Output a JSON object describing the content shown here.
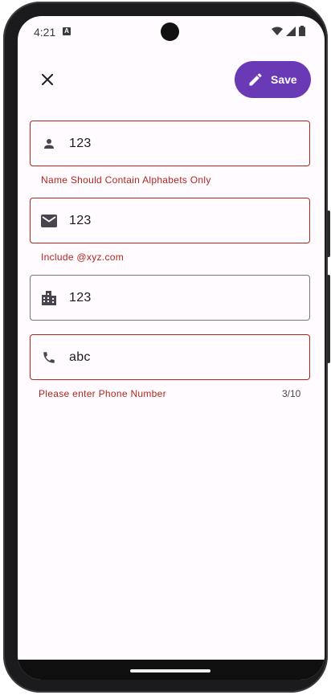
{
  "status_bar": {
    "time": "4:21",
    "a_icon": "A"
  },
  "app_bar": {
    "close_icon": "close-icon",
    "save_label": "Save",
    "save_icon": "pencil-icon"
  },
  "fields": [
    {
      "icon": "person-icon",
      "value": "123",
      "supporting_text": "Name Should Contain Alphabets Only",
      "state": "error"
    },
    {
      "icon": "mail-icon",
      "value": "123",
      "supporting_text": "Include @xyz.com",
      "state": "error"
    },
    {
      "icon": "building-icon",
      "value": "123",
      "supporting_text": "",
      "state": "normal"
    },
    {
      "icon": "phone-icon",
      "value": "abc",
      "supporting_text": "Please enter Phone Number",
      "counter": "3/10",
      "state": "error"
    }
  ],
  "colors": {
    "primary": "#6a3ab6",
    "error": "#b3261e",
    "outline": "#79747e",
    "surface": "#fffbfe"
  }
}
